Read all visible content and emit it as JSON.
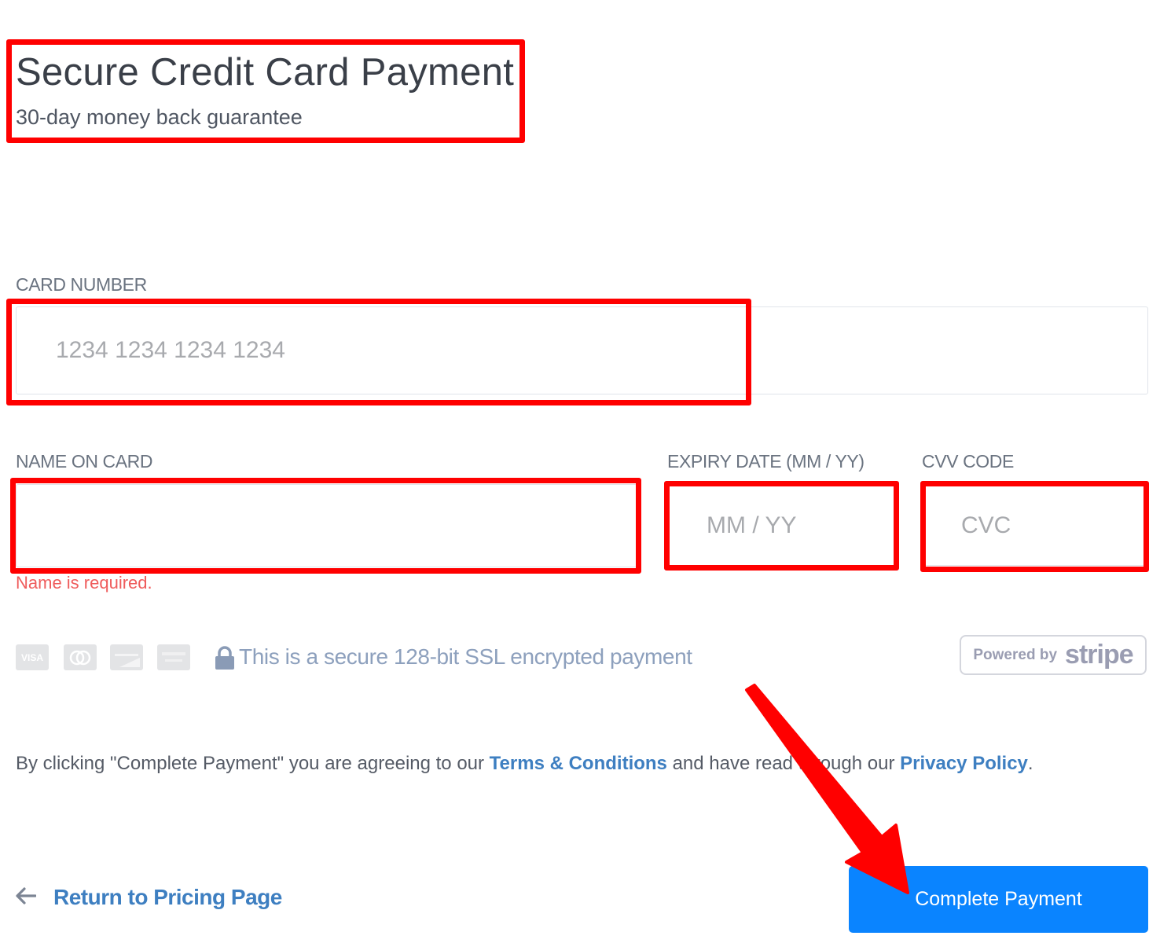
{
  "header": {
    "title": "Secure Credit Card Payment",
    "subtitle": "30-day money back guarantee"
  },
  "form": {
    "card_number": {
      "label": "CARD NUMBER",
      "value": "",
      "placeholder": "1234 1234 1234 1234"
    },
    "name_on_card": {
      "label": "NAME ON CARD",
      "value": "",
      "placeholder": "",
      "error": "Name is required."
    },
    "expiry": {
      "label": "EXPIRY DATE (MM / YY)",
      "value": "",
      "placeholder": "MM / YY"
    },
    "cvv": {
      "label": "CVV CODE",
      "value": "",
      "placeholder": "CVC"
    }
  },
  "security": {
    "card_icons": [
      {
        "name": "visa-icon",
        "text": "VISA"
      },
      {
        "name": "mastercard-icon",
        "text": ""
      },
      {
        "name": "discover-icon",
        "text": ""
      },
      {
        "name": "amex-icon",
        "text": ""
      }
    ],
    "lock_icon": "lock-icon",
    "message": "This is a secure 128-bit SSL encrypted payment",
    "badge": {
      "powered_by": "Powered by",
      "brand": "stripe"
    }
  },
  "terms": {
    "prefix": "By clicking \"Complete Payment\" you are agreeing to our ",
    "terms_link": "Terms & Conditions",
    "middle": " and have read through our ",
    "privacy_link": "Privacy Policy",
    "suffix": "."
  },
  "footer": {
    "back_icon": "arrow-left-icon",
    "back_label": "Return to Pricing Page",
    "submit_label": "Complete Payment"
  },
  "colors": {
    "primary_button": "#0a84ff",
    "link": "#3e7fc1",
    "error": "#ef5c5c",
    "annotation": "#ff0000"
  }
}
